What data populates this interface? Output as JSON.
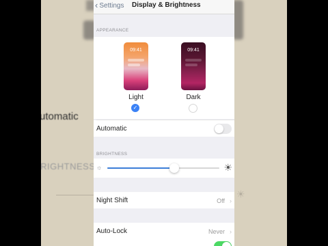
{
  "nav": {
    "back_label": "Settings",
    "title": "Display & Brightness"
  },
  "appearance": {
    "header": "APPEARANCE",
    "options": [
      {
        "label": "Light",
        "time": "09:41",
        "selected": true
      },
      {
        "label": "Dark",
        "time": "09:41",
        "selected": false
      }
    ]
  },
  "automatic": {
    "label": "Automatic",
    "on": false
  },
  "brightness": {
    "header": "BRIGHTNESS",
    "level": 0.6
  },
  "night_shift": {
    "label": "Night Shift",
    "value": "Off"
  },
  "auto_lock": {
    "label": "Auto-Lock",
    "value": "Never"
  },
  "background": {
    "automatic_text": "Automatic",
    "brightness_text": "BRIGHTNESS"
  },
  "colors": {
    "accent": "#3b82f6",
    "toggle_on": "#4cd964",
    "group_bg": "#efeff4"
  },
  "icons": [
    "chevron-left-icon",
    "checkmark-icon",
    "sun-small-icon",
    "sun-large-icon",
    "chevron-right-icon"
  ]
}
